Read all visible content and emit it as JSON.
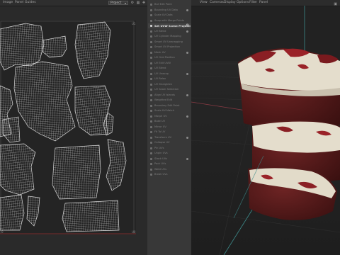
{
  "uv_editor": {
    "menu": [
      "Image",
      "Panel",
      "Guides"
    ],
    "projection_dropdown": "Project",
    "labels": {
      "top_right": "U1",
      "bottom_right": "U0",
      "bottom_left": "0"
    }
  },
  "outliner": {
    "items": [
      {
        "label": "Ball Edit Paint",
        "selected": false
      },
      {
        "label": "Bounding UV Data",
        "selected": false
      },
      {
        "label": "Scale UV Data",
        "selected": false
      },
      {
        "label": "Snap with Merge Points",
        "selected": false
      },
      {
        "label": "Set UVW Scene Projection",
        "selected": true
      },
      {
        "label": "UV Blend",
        "selected": false
      },
      {
        "label": "UV Cylinder Mapping",
        "selected": false
      },
      {
        "label": "Smart UV Unwrapping",
        "selected": false
      },
      {
        "label": "Smart UV Projection",
        "selected": false
      },
      {
        "label": "Mesh UV",
        "selected": false
      },
      {
        "label": "UV Grid Position",
        "selected": false
      },
      {
        "label": "UV Edit UVW",
        "selected": false
      },
      {
        "label": "UV Blend",
        "selected": false
      },
      {
        "label": "UV Unwrap",
        "selected": false
      },
      {
        "label": "UV Relax",
        "selected": false
      },
      {
        "label": "UV Straighten",
        "selected": false
      },
      {
        "label": "UV Seam Selection",
        "selected": false
      },
      {
        "label": "Align UV Islands",
        "selected": false
      },
      {
        "label": "Weighted Edit",
        "selected": false
      },
      {
        "label": "Boundary Edit Paint",
        "selected": false
      },
      {
        "label": "Scale UV Match",
        "selected": false
      },
      {
        "label": "Morph UV",
        "selected": false
      },
      {
        "label": "Bake UV",
        "selected": false
      },
      {
        "label": "Mirror UV",
        "selected": false
      },
      {
        "label": "Fit To UV",
        "selected": false
      },
      {
        "label": "Transform UV",
        "selected": false
      },
      {
        "label": "Collapse UV",
        "selected": false
      },
      {
        "label": "Pin UVs",
        "selected": false
      },
      {
        "label": "Unpin UVs",
        "selected": false
      },
      {
        "label": "Stack UVs",
        "selected": false
      },
      {
        "label": "Pack UVs",
        "selected": false
      },
      {
        "label": "Weld UVs",
        "selected": false
      },
      {
        "label": "Break UVs",
        "selected": false
      }
    ]
  },
  "viewport": {
    "menu": [
      "View",
      "Cameras",
      "Display",
      "Options",
      "Filter",
      "Panel"
    ]
  },
  "colors": {
    "wire": "#d4d4d4",
    "uv_bg": "#242424",
    "selected_row": "#424242",
    "frosting": "#e6e0d2",
    "cake": "#5a1c1c"
  }
}
